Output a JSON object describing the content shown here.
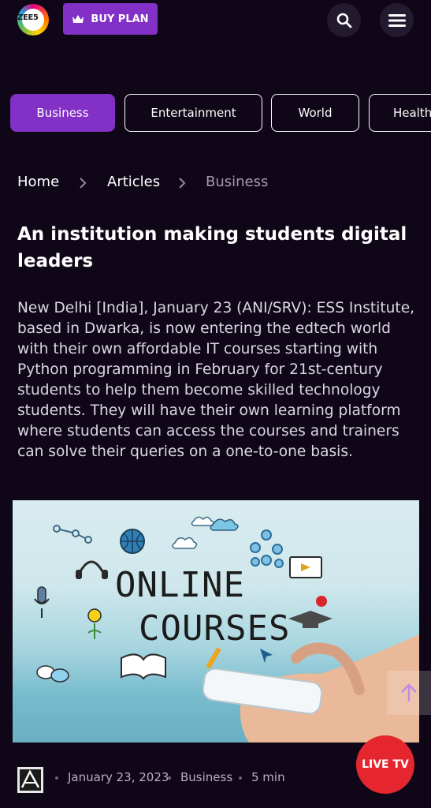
{
  "header": {
    "logo_text": "ZEE5",
    "buy_plan_label": "BUY PLAN"
  },
  "categories": [
    {
      "label": "Business",
      "active": true
    },
    {
      "label": "Entertainment",
      "active": false
    },
    {
      "label": "World",
      "active": false
    },
    {
      "label": "Health",
      "active": false
    }
  ],
  "breadcrumb": {
    "home": "Home",
    "articles": "Articles",
    "current": "Business"
  },
  "article": {
    "title": "An institution making students digital leaders",
    "body": "New Delhi [India], January 23 (ANI/SRV): ESS Institute, based in Dwarka, is now entering the edtech world with their own affordable IT courses starting with Python programming in February for 21st-century students to help them become skilled technology students. They will have their own learning platform where students can access the courses and trainers can solve their queries on a one-to-one basis.",
    "hero_line1": "ONLINE",
    "hero_line2": "COURSES",
    "date": "January 23, 2023",
    "category": "Business",
    "read_time": "5 min"
  },
  "live_tv_label": "LIVE TV",
  "colors": {
    "background": "#0f0717",
    "accent": "#8230c6",
    "live": "#e5262e"
  }
}
